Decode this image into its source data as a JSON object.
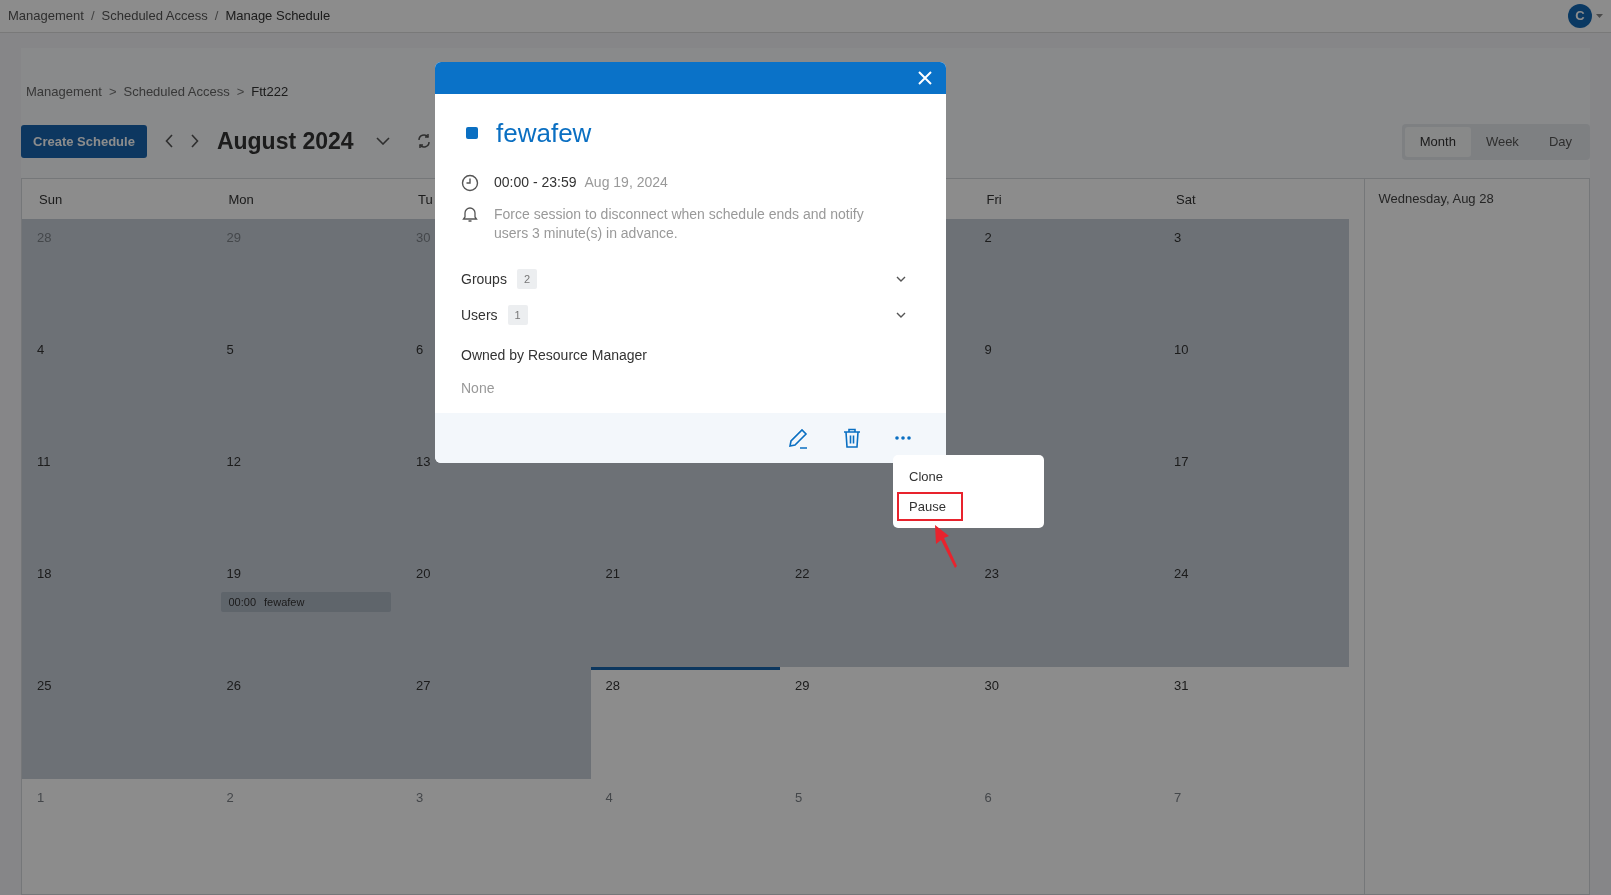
{
  "top_bar": {
    "breadcrumb": [
      "Management",
      "Scheduled Access",
      "Manage Schedule"
    ],
    "separator": "/",
    "avatar": "C"
  },
  "page_breadcrumb": {
    "items": [
      "Management",
      "Scheduled Access",
      "Ftt222"
    ],
    "separator": ">"
  },
  "toolbar": {
    "create_button": "Create Schedule",
    "month_label": "August 2024"
  },
  "views": [
    {
      "label": "Month",
      "selected": true
    },
    {
      "label": "Week",
      "selected": false
    },
    {
      "label": "Day",
      "selected": false
    }
  ],
  "calendar": {
    "weekdays": {
      "left": [
        "Sun",
        "Mon",
        "Tu"
      ],
      "right": [
        "Fri",
        "Sat"
      ]
    },
    "weeks": [
      {
        "left": [
          {
            "day": "28",
            "outside": true,
            "past": true
          },
          {
            "day": "29",
            "outside": true,
            "past": true
          },
          {
            "day": "30",
            "outside": true,
            "past": true
          }
        ],
        "right": [
          {
            "day": "2",
            "outside": false,
            "past": true
          },
          {
            "day": "3",
            "outside": false,
            "past": true
          }
        ]
      },
      {
        "left": [
          {
            "day": "4",
            "outside": false,
            "past": true
          },
          {
            "day": "5",
            "outside": false,
            "past": true
          },
          {
            "day": "6",
            "outside": false,
            "past": true
          }
        ],
        "right": [
          {
            "day": "9",
            "outside": false,
            "past": true
          },
          {
            "day": "10",
            "outside": false,
            "past": true
          }
        ]
      },
      {
        "left": [
          {
            "day": "11",
            "outside": false,
            "past": true
          },
          {
            "day": "12",
            "outside": false,
            "past": true
          },
          {
            "day": "13",
            "outside": false,
            "past": true
          }
        ],
        "right": [
          {
            "day": "17",
            "outside": false,
            "past": true
          }
        ]
      },
      {
        "days": [
          {
            "day": "18",
            "outside": false,
            "past": true
          },
          {
            "day": "19",
            "outside": false,
            "past": true,
            "events": [
              {
                "time": "00:00",
                "title": "fewafew"
              }
            ]
          },
          {
            "day": "20",
            "outside": false,
            "past": true
          },
          {
            "day": "21",
            "outside": false,
            "past": true
          },
          {
            "day": "22",
            "outside": false,
            "past": true
          },
          {
            "day": "23",
            "outside": false,
            "past": true
          },
          {
            "day": "24",
            "outside": false,
            "past": true
          }
        ]
      },
      {
        "days": [
          {
            "day": "25",
            "outside": false,
            "past": true
          },
          {
            "day": "26",
            "outside": false,
            "past": true
          },
          {
            "day": "27",
            "outside": false,
            "past": true
          },
          {
            "day": "28",
            "outside": false,
            "past": false,
            "today": true
          },
          {
            "day": "29",
            "outside": false,
            "past": false
          },
          {
            "day": "30",
            "outside": false,
            "past": false
          },
          {
            "day": "31",
            "outside": false,
            "past": false
          }
        ]
      },
      {
        "days": [
          {
            "day": "1",
            "outside": true,
            "past": false
          },
          {
            "day": "2",
            "outside": true,
            "past": false
          },
          {
            "day": "3",
            "outside": true,
            "past": false
          },
          {
            "day": "4",
            "outside": true,
            "past": false
          },
          {
            "day": "5",
            "outside": true,
            "past": false
          },
          {
            "day": "6",
            "outside": true,
            "past": false
          },
          {
            "day": "7",
            "outside": true,
            "past": false
          }
        ]
      }
    ]
  },
  "side_panel": {
    "title": "Wednesday, Aug 28"
  },
  "popup": {
    "color": "#0a6fc2",
    "title": "fewafew",
    "time": "00:00 - 23:59",
    "date": "Aug 19, 2024",
    "notice": "Force session to disconnect when schedule ends and notify users 3 minute(s) in advance.",
    "sections": [
      {
        "label": "Groups",
        "count": "2",
        "expanded": false
      },
      {
        "label": "Users",
        "count": "1",
        "expanded": false
      }
    ],
    "owner_label": "Owned by Resource Manager",
    "owner_value": "None",
    "menu": [
      {
        "label": "Clone",
        "highlighted": false
      },
      {
        "label": "Pause",
        "highlighted": true
      }
    ]
  }
}
